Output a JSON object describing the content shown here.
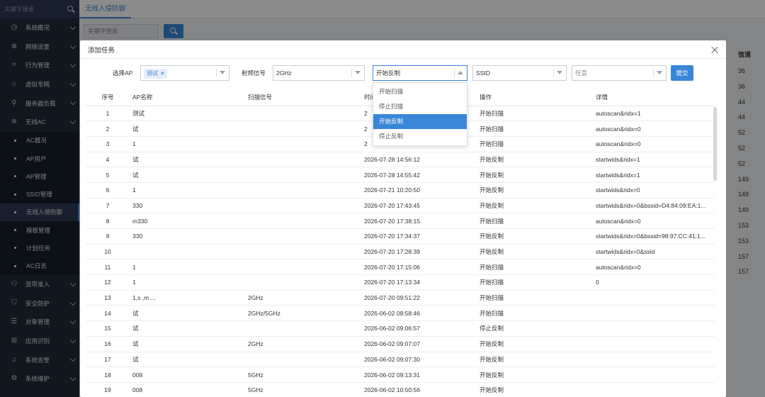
{
  "sidebar": {
    "search_placeholder": "关键字搜索",
    "items": [
      {
        "label": "系统概况",
        "icon": "◷"
      },
      {
        "label": "网络设置",
        "icon": "⊗"
      },
      {
        "label": "行为管理",
        "icon": "⌗"
      },
      {
        "label": "虚拟专网",
        "icon": "⌂"
      },
      {
        "label": "服务器负载",
        "icon": "⚲"
      },
      {
        "label": "无线AC",
        "icon": "≋"
      }
    ],
    "sub_items": [
      {
        "label": "AC概况"
      },
      {
        "label": "AP用户"
      },
      {
        "label": "AP管理"
      },
      {
        "label": "SSID管理"
      },
      {
        "label": "无线入侵防御",
        "active": true
      },
      {
        "label": "模板管理"
      },
      {
        "label": "计划任务"
      },
      {
        "label": "AC日志"
      }
    ],
    "items_after": [
      {
        "label": "宽带准入",
        "icon": "⚇"
      },
      {
        "label": "安全防护",
        "icon": "⛉"
      },
      {
        "label": "对象管理",
        "icon": "☰"
      },
      {
        "label": "应用识别",
        "icon": "⊞"
      },
      {
        "label": "系统告警",
        "icon": "♫"
      },
      {
        "label": "系统维护",
        "icon": "⚙"
      }
    ]
  },
  "topbar": {
    "tab_label": "无线入侵防御"
  },
  "background": {
    "search_placeholder": "关键字搜索",
    "channel_header": "信道",
    "channels": [
      "36",
      "36",
      "44",
      "44",
      "52",
      "52",
      "52",
      "149",
      "149",
      "149",
      "153",
      "153",
      "157",
      "157"
    ]
  },
  "modal": {
    "title": "添加任务",
    "filters": {
      "ap_label": "选择AP",
      "ap_tag": "测试",
      "freq_label": "射频信号",
      "freq_value": "2GHz",
      "action_value": "开始反制",
      "ssid_value": "SSID",
      "any_placeholder": "任意",
      "submit_label": "提交"
    },
    "dropdown_options": [
      {
        "label": "开始扫描",
        "selected": false
      },
      {
        "label": "停止扫描",
        "selected": false
      },
      {
        "label": "开始反制",
        "selected": true
      },
      {
        "label": "停止反制",
        "selected": false
      }
    ],
    "table": {
      "headers": {
        "no": "序号",
        "ap": "AP名称",
        "scan": "扫描信号",
        "time": "时间",
        "op": "操作",
        "detail": "详情"
      },
      "rows": [
        {
          "no": "1",
          "ap": "测试",
          "scan": "",
          "time": "2",
          "op": "开始扫描",
          "detail": "autoscan&ridx=1"
        },
        {
          "no": "2",
          "ap": "试",
          "scan": "",
          "time": "2",
          "op": "开始扫描",
          "detail": "autoscan&ridx=0"
        },
        {
          "no": "3",
          "ap": "1",
          "scan": "",
          "time": "2",
          "op": "开始扫描",
          "detail": "autoscan&ridx=0"
        },
        {
          "no": "4",
          "ap": "试",
          "scan": "",
          "time": "2026-07-28 14:56:12",
          "op": "开始反制",
          "detail": "startwids&ridx=1"
        },
        {
          "no": "5",
          "ap": "试",
          "scan": "",
          "time": "2026-07-28 14:55:42",
          "op": "开始反制",
          "detail": "startwids&ridx=1"
        },
        {
          "no": "6",
          "ap": "1",
          "scan": "",
          "time": "2026-07-21 10:20:50",
          "op": "开始反制",
          "detail": "startwids&ridx=0"
        },
        {
          "no": "7",
          "ap": "330",
          "scan": "",
          "time": "2026-07-20 17:43:45",
          "op": "开始反制",
          "detail": "startwids&ridx=0&bssid=D4:84:09:EA:1..."
        },
        {
          "no": "8",
          "ap": "m330",
          "scan": "",
          "time": "2026-07-20 17:38:15",
          "op": "开始扫描",
          "detail": "autoscan&ridx=0"
        },
        {
          "no": "9",
          "ap": "330",
          "scan": "",
          "time": "2026-07-20 17:34:37",
          "op": "开始反制",
          "detail": "startwids&ridx=0&bssid=98:97:CC:41:1..."
        },
        {
          "no": "10",
          "ap": "",
          "scan": "",
          "time": "2026-07-20 17:28:39",
          "op": "开始反制",
          "detail": "startwids&ridx=0&ssid"
        },
        {
          "no": "11",
          "ap": "1",
          "scan": "",
          "time": "2026-07-20 17:15:06",
          "op": "开始扫描",
          "detail": "autoscan&ridx=0"
        },
        {
          "no": "12",
          "ap": "1",
          "scan": "",
          "time": "2026-07-20 17:13:34",
          "op": "开始扫描",
          "detail": "0"
        },
        {
          "no": "13",
          "ap": "1,s ,m ...",
          "scan": "2GHz",
          "time": "2026-07-20 09:51:22",
          "op": "开始扫描",
          "detail": ""
        },
        {
          "no": "14",
          "ap": "试",
          "scan": "2GHz/5GHz",
          "time": "2026-06-02 08:58:46",
          "op": "开始扫描",
          "detail": ""
        },
        {
          "no": "15",
          "ap": "试",
          "scan": "",
          "time": "2026-06-02 09:06:57",
          "op": "停止反制",
          "detail": ""
        },
        {
          "no": "16",
          "ap": "试",
          "scan": "2GHz",
          "time": "2026-06-02 09:07:07",
          "op": "开始反制",
          "detail": ""
        },
        {
          "no": "17",
          "ap": "试",
          "scan": "",
          "time": "2026-06-02 09:07:30",
          "op": "开始反制",
          "detail": ""
        },
        {
          "no": "18",
          "ap": "008",
          "scan": "5GHz",
          "time": "2026-06-02 09:13:31",
          "op": "开始反制",
          "detail": ""
        },
        {
          "no": "19",
          "ap": "008",
          "scan": "5GHz",
          "time": "2026-06-02 10:50:56",
          "op": "开始反制",
          "detail": ""
        }
      ]
    }
  }
}
